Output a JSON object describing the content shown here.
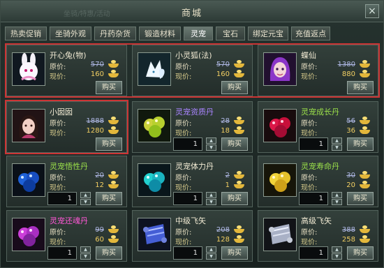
{
  "window": {
    "title": "商城",
    "ghost_text": "坐骑/特惠/活动"
  },
  "icons": {
    "close": "close-icon",
    "gold": "yuanbao-gold-icon"
  },
  "tabs": [
    {
      "label": "热卖促销",
      "active": false
    },
    {
      "label": "坐骑外观",
      "active": false
    },
    {
      "label": "丹药杂货",
      "active": false
    },
    {
      "label": "锻造材料",
      "active": false
    },
    {
      "label": "灵宠",
      "active": true
    },
    {
      "label": "宝石",
      "active": false
    },
    {
      "label": "绑定元宝",
      "active": false
    },
    {
      "label": "充值返点",
      "active": false
    }
  ],
  "labels": {
    "original": "原价:",
    "current": "现价:",
    "buy": "购买"
  },
  "colors": {
    "name_white": "#f1ead3",
    "name_purple": "#a984ff",
    "name_green": "#9be04a",
    "name_magenta": "#ff57d6",
    "highlight": "#cc3434"
  },
  "items": [
    {
      "name": "开心兔(物)",
      "original": "570",
      "current": "160",
      "qty": null,
      "name_color": "#f1ead3",
      "thumb": "white-rabbit-pet-icon"
    },
    {
      "name": "小灵狐(法)",
      "original": "570",
      "current": "160",
      "qty": null,
      "name_color": "#f1ead3",
      "thumb": "white-fox-pet-icon"
    },
    {
      "name": "蝶仙",
      "original": "1380",
      "current": "880",
      "qty": null,
      "name_color": "#f1ead3",
      "thumb": "purple-hair-fairy-icon"
    },
    {
      "name": "小囡囡",
      "original": "1888",
      "current": "1280",
      "qty": null,
      "name_color": "#f1ead3",
      "thumb": "girl-pet-icon"
    },
    {
      "name": "灵宠资质丹",
      "original": "28",
      "current": "18",
      "qty": "1",
      "name_color": "#a984ff",
      "thumb": "yellow-green-pills-icon"
    },
    {
      "name": "灵宠成长丹",
      "original": "56",
      "current": "36",
      "qty": "1",
      "name_color": "#9be04a",
      "thumb": "red-pills-icon"
    },
    {
      "name": "灵宠悟性丹",
      "original": "20",
      "current": "12",
      "qty": "1",
      "name_color": "#9be04a",
      "thumb": "blue-pills-icon"
    },
    {
      "name": "灵宠体力丹",
      "original": "2",
      "current": "1",
      "qty": "1",
      "name_color": "#f1ead3",
      "thumb": "cyan-pills-icon"
    },
    {
      "name": "灵宠寿命丹",
      "original": "30",
      "current": "20",
      "qty": "1",
      "name_color": "#9be04a",
      "thumb": "yellow-pills-icon"
    },
    {
      "name": "灵宠还魂丹",
      "original": "99",
      "current": "60",
      "qty": "1",
      "name_color": "#ff57d6",
      "thumb": "purple-pills-icon"
    },
    {
      "name": "中级飞矢",
      "original": "208",
      "current": "128",
      "qty": "1",
      "name_color": "#f1ead3",
      "thumb": "blue-scroll-icon"
    },
    {
      "name": "高级飞矢",
      "original": "388",
      "current": "258",
      "qty": "1",
      "name_color": "#f1ead3",
      "thumb": "gray-scroll-icon"
    }
  ]
}
